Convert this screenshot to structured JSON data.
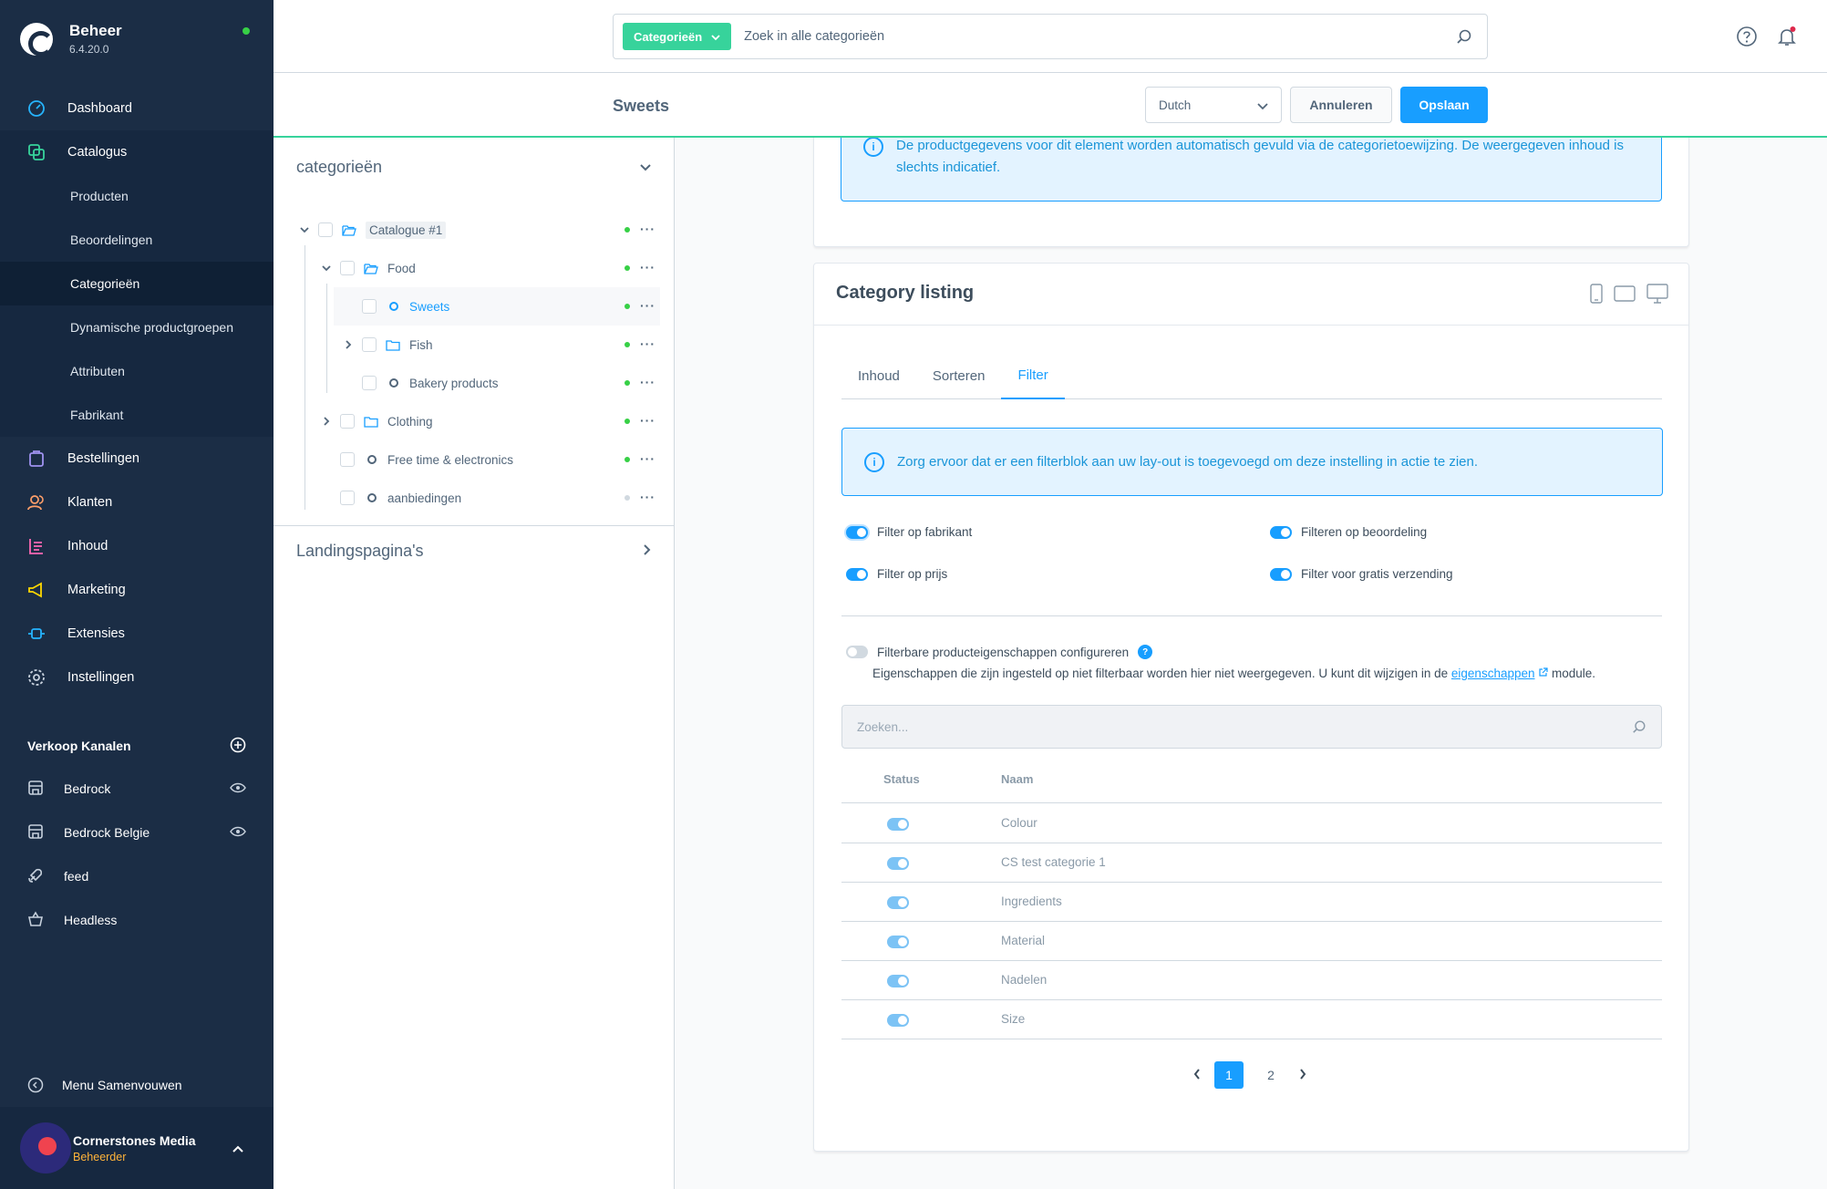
{
  "app": {
    "title": "Beheer",
    "version": "6.4.20.0"
  },
  "sidebar": {
    "items": [
      {
        "label": "Dashboard",
        "icon": "dashboard-icon"
      },
      {
        "label": "Catalogus",
        "icon": "catalog-icon"
      },
      {
        "label": "Bestellingen",
        "icon": "orders-icon"
      },
      {
        "label": "Klanten",
        "icon": "customers-icon"
      },
      {
        "label": "Inhoud",
        "icon": "content-icon"
      },
      {
        "label": "Marketing",
        "icon": "marketing-icon"
      },
      {
        "label": "Extensies",
        "icon": "extensions-icon"
      },
      {
        "label": "Instellingen",
        "icon": "settings-icon"
      }
    ],
    "catalog_sub": [
      "Producten",
      "Beoordelingen",
      "Categorieën",
      "Dynamische productgroepen",
      "Attributen",
      "Fabrikant"
    ],
    "channels_title": "Verkoop Kanalen",
    "channels": [
      "Bedrock",
      "Bedrock Belgie",
      "feed",
      "Headless"
    ],
    "collapse_label": "Menu Samenvouwen",
    "user": {
      "name": "Cornerstones Media",
      "role": "Beheerder"
    }
  },
  "search": {
    "type_label": "Categorieën",
    "placeholder": "Zoek in alle categorieën"
  },
  "smartbar": {
    "title": "Sweets",
    "language": "Dutch",
    "cancel": "Annuleren",
    "save": "Opslaan"
  },
  "tree": {
    "title": "categorieën",
    "items": [
      {
        "label": "Catalogue #1"
      },
      {
        "label": "Food"
      },
      {
        "label": "Sweets"
      },
      {
        "label": "Fish"
      },
      {
        "label": "Bakery products"
      },
      {
        "label": "Clothing"
      },
      {
        "label": "Free time & electronics"
      },
      {
        "label": "aanbiedingen"
      }
    ],
    "landing_title": "Landingspagina's"
  },
  "content": {
    "top_alert": "De productgegevens voor dit element worden automatisch gevuld via de categorietoewijzing. De weergegeven inhoud is slechts indicatief.",
    "listing_title": "Category listing",
    "tabs": [
      "Inhoud",
      "Sorteren",
      "Filter"
    ],
    "filter_alert": "Zorg ervoor dat er een filterblok aan uw lay-out is toegevoegd om deze instelling in actie te zien.",
    "switches": [
      "Filter op fabrikant",
      "Filteren op beoordeling",
      "Filter op prijs",
      "Filter voor gratis verzending"
    ],
    "configure_label": "Filterbare producteigenschappen configureren",
    "hint_before": "Eigenschappen die zijn ingesteld op niet filterbaar worden hier niet weergegeven. U kunt dit wijzigen in de",
    "hint_link": "eigenschappen",
    "hint_after": "module.",
    "property_search_placeholder": "Zoeken...",
    "grid_headers": [
      "Status",
      "Naam"
    ],
    "properties": [
      "Colour",
      "CS test categorie 1",
      "Ingredients",
      "Material",
      "Nadelen",
      "Size"
    ],
    "pages": [
      "1",
      "2"
    ]
  },
  "colors": {
    "accent": "#189eff",
    "sidebar": "#1b2d45",
    "green": "#37d39b",
    "alert_bg": "#e3f3ff"
  }
}
